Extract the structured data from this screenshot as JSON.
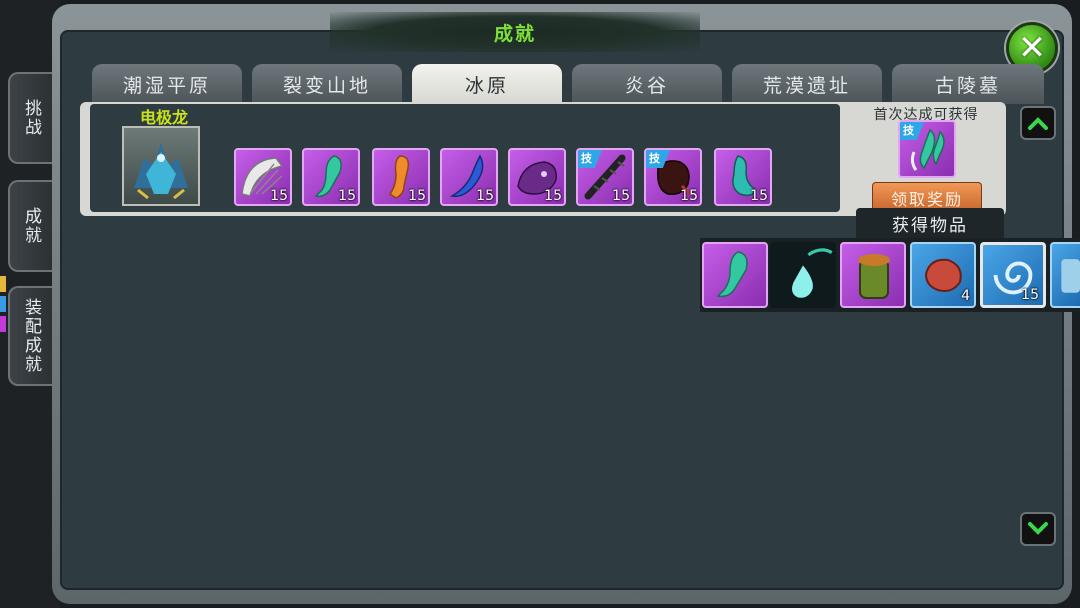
{
  "title": "成就",
  "side_tabs": [
    {
      "label": "挑战"
    },
    {
      "label": "成就"
    },
    {
      "label": "装配成就"
    }
  ],
  "region_tabs": [
    {
      "label": "潮湿平原",
      "active": false
    },
    {
      "label": "裂变山地",
      "active": false
    },
    {
      "label": "冰原",
      "active": true
    },
    {
      "label": "炎谷",
      "active": false
    },
    {
      "label": "荒漠遗址",
      "active": false
    },
    {
      "label": "古陵墓",
      "active": false
    }
  ],
  "achievement": {
    "monster_name": "电极龙",
    "items": [
      {
        "icon": "scale-fan-icon",
        "count": "15",
        "skill": false
      },
      {
        "icon": "green-claw-icon",
        "count": "15",
        "skill": false
      },
      {
        "icon": "orange-leg-icon",
        "count": "15",
        "skill": false
      },
      {
        "icon": "blue-horn-icon",
        "count": "15",
        "skill": false
      },
      {
        "icon": "purple-head-icon",
        "count": "15",
        "skill": false
      },
      {
        "icon": "spike-tail-icon",
        "count": "15",
        "skill": true,
        "skill_label": "技"
      },
      {
        "icon": "dark-gauntlet-icon",
        "count": "15",
        "skill": true,
        "skill_label": "技"
      },
      {
        "icon": "teal-tail-icon",
        "count": "15",
        "skill": false
      }
    ],
    "reward_label": "首次达成可获得",
    "reward_item": {
      "icon": "claw-skill-icon",
      "skill_label": "技"
    },
    "claim_button": "领取奖励"
  },
  "obtained": {
    "label": "获得物品",
    "items": [
      {
        "icon": "green-claw-icon",
        "count": ""
      },
      {
        "icon": "water-drop-icon",
        "count": ""
      },
      {
        "icon": "jar-icon",
        "count": ""
      },
      {
        "icon": "meat-icon",
        "count": "4"
      },
      {
        "icon": "vortex-icon",
        "count": "15"
      },
      {
        "icon": "bottle-icon",
        "count": ""
      }
    ]
  },
  "colors": {
    "title": "#7fe03a",
    "monster_name": "#c9e21a",
    "item_bg": "#b04ed8",
    "skill_badge": "#2ea6e8",
    "claim_button": "#e07a3a"
  }
}
